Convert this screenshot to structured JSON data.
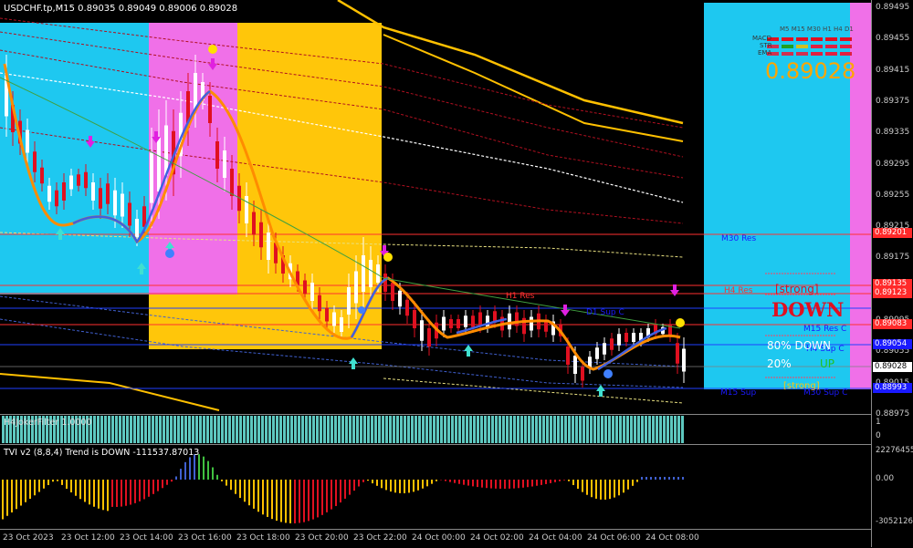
{
  "window": {
    "symbol_line": "USDCHF.tp,M15  0.89035 0.89049 0.89006 0.89028"
  },
  "price_axis": {
    "ticks": [
      "0.89495",
      "0.89455",
      "0.89415",
      "0.89375",
      "0.89335",
      "0.89295",
      "0.89255",
      "0.89215",
      "0.89175",
      "0.89135",
      "0.89095",
      "0.89055",
      "0.89015",
      "0.88975"
    ],
    "tags": [
      {
        "text": "0.89201",
        "color": "#ff2a2a"
      },
      {
        "text": "0.89135",
        "color": "#ff2a2a"
      },
      {
        "text": "0.89123",
        "color": "#ff2a2a"
      },
      {
        "text": "0.89083",
        "color": "#ff2a2a"
      },
      {
        "text": "0.89054",
        "color": "#1a1aff"
      },
      {
        "text": "0.89028",
        "color": "#ffffff"
      },
      {
        "text": "0.88993",
        "color": "#1a1aff"
      }
    ]
  },
  "levels": {
    "m30_res": "M30 Res",
    "h4_res": "H4 Res",
    "h1_res": "H1 Res",
    "d1_sup": "D1 Sup C",
    "m15_res": "M15 Res C",
    "h4_sup": "H4 Sup C",
    "m15_sup": "M15 Sup",
    "m30_sup": "M30 Sup C"
  },
  "info_panel": {
    "header": "M5 M15 M30 H1 H4 D1",
    "row_labels": [
      "MACD",
      "STR",
      "EMA"
    ],
    "price": "0.89028",
    "strength": "[strong]",
    "direction": "DOWN",
    "down_pct": "80% DOWN",
    "up_pct": "20%",
    "up_word": "UP",
    "strength_bottom": "[strong]",
    "colors": {
      "cyan": "#1ec8f0",
      "magenta": "#f070e8",
      "yellow": "#ffc60a",
      "red": "#e01020"
    }
  },
  "sub1": {
    "title": "H4JokerFilter 1.0000",
    "scale_top": "1",
    "scale_bottom": "0"
  },
  "sub2": {
    "title": "TVI v2 (8,8,4) Trend is DOWN -111537.87013",
    "scale_top": "22276455",
    "scale_mid": "0.00",
    "scale_bottom": "-30521268"
  },
  "time_axis": {
    "labels": [
      "23 Oct 2023",
      "23 Oct 12:00",
      "23 Oct 14:00",
      "23 Oct 16:00",
      "23 Oct 18:00",
      "23 Oct 20:00",
      "23 Oct 22:00",
      "24 Oct 00:00",
      "24 Oct 02:00",
      "24 Oct 04:00",
      "24 Oct 06:00",
      "24 Oct 08:00"
    ]
  }
}
